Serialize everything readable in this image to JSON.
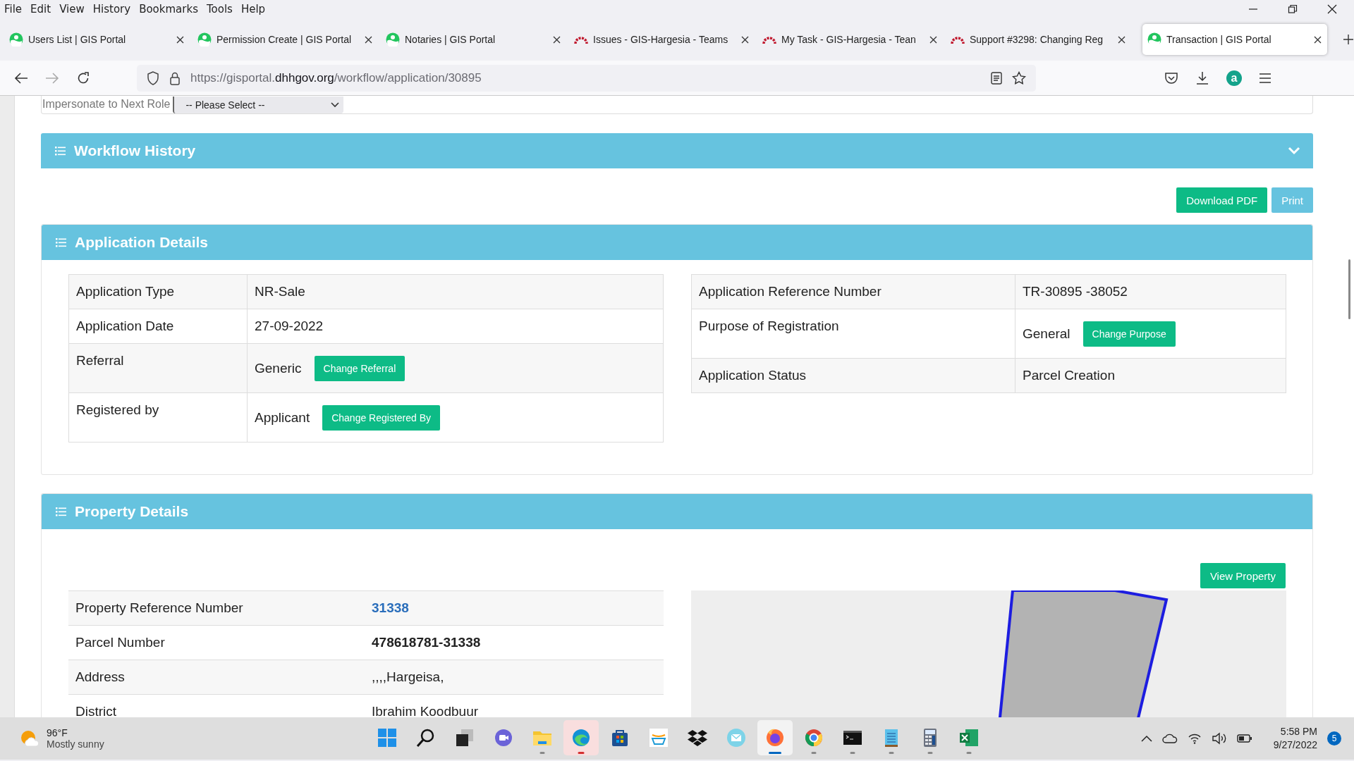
{
  "menu_bar": [
    "File",
    "Edit",
    "View",
    "History",
    "Bookmarks",
    "Tools",
    "Help"
  ],
  "tabs": [
    {
      "title": "Users List | GIS Portal",
      "kind": "portal",
      "selected": false
    },
    {
      "title": "Permission Create | GIS Portal",
      "kind": "portal",
      "selected": false
    },
    {
      "title": "Notaries | GIS Portal",
      "kind": "portal",
      "selected": false
    },
    {
      "title": "Issues - GIS-Hargesia - Teams",
      "kind": "tracker",
      "selected": false
    },
    {
      "title": "My Task - GIS-Hargesia - Tean",
      "kind": "tracker",
      "selected": false
    },
    {
      "title": "Support #3298: Changing Reg",
      "kind": "tracker",
      "selected": false
    },
    {
      "title": "Transaction | GIS Portal",
      "kind": "portal",
      "selected": true
    }
  ],
  "address_bar": {
    "scheme_host": "https://gisportal.",
    "domain": "dhhgov.org",
    "path": "/workflow/application/30895"
  },
  "account_badge": "a",
  "impersonate": {
    "label": "Impersonate to Next Role",
    "select_value": "-- Please Select --"
  },
  "workflow_history": {
    "title": "Workflow History"
  },
  "actions": [
    {
      "label": "Download PDF",
      "kind": "success"
    },
    {
      "label": "Print",
      "kind": "info"
    }
  ],
  "application_details": {
    "title": "Application Details",
    "left_rows": [
      {
        "label": "Application Type",
        "value": "NR-Sale"
      },
      {
        "label": "Application Date",
        "value": "27-09-2022"
      },
      {
        "label": "Referral",
        "value": "Generic",
        "action": "Change Referral"
      },
      {
        "label": "Registered by",
        "value": "Applicant",
        "action": "Change Registered By"
      }
    ],
    "right_rows": [
      {
        "label": "Application Reference Number",
        "value": "TR-30895 -38052"
      },
      {
        "label": "Purpose of Registration",
        "value": "General",
        "action": "Change Purpose"
      },
      {
        "label": "Application Status",
        "value": "Parcel Creation"
      }
    ]
  },
  "property_details": {
    "title": "Property Details",
    "view_button": "View Property",
    "rows": [
      {
        "label": "Property Reference Number",
        "value": "31338",
        "kind": "link"
      },
      {
        "label": "Parcel Number",
        "value": "478618781-31338",
        "kind": "bold"
      },
      {
        "label": "Address",
        "value": ",,,,Hargeisa,",
        "kind": "plain"
      },
      {
        "label": "District",
        "value": "Ibrahim Koodbuur",
        "kind": "plain"
      }
    ]
  },
  "taskbar": {
    "weather": {
      "temperature": "96°F",
      "condition": "Mostly sunny"
    },
    "apps": [
      {
        "kind": "start",
        "running": false,
        "selected": false,
        "attention": false
      },
      {
        "kind": "search",
        "running": false,
        "selected": false,
        "attention": false
      },
      {
        "kind": "taskview",
        "running": false,
        "selected": false,
        "attention": false
      },
      {
        "kind": "chat",
        "running": false,
        "selected": false,
        "attention": false
      },
      {
        "kind": "explorer",
        "running": true,
        "selected": false,
        "attention": false
      },
      {
        "kind": "edge",
        "running": true,
        "selected": false,
        "attention": true
      },
      {
        "kind": "store",
        "running": false,
        "selected": false,
        "attention": false
      },
      {
        "kind": "amazon",
        "running": false,
        "selected": false,
        "attention": false
      },
      {
        "kind": "dropbox",
        "running": false,
        "selected": false,
        "attention": false
      },
      {
        "kind": "mail",
        "running": false,
        "selected": false,
        "attention": false
      },
      {
        "kind": "firefox",
        "running": true,
        "selected": true,
        "attention": false
      },
      {
        "kind": "chrome",
        "running": true,
        "selected": false,
        "attention": false
      },
      {
        "kind": "terminal",
        "running": true,
        "selected": false,
        "attention": false
      },
      {
        "kind": "notepad",
        "running": true,
        "selected": false,
        "attention": false
      },
      {
        "kind": "calculator",
        "running": true,
        "selected": false,
        "attention": false
      },
      {
        "kind": "excel",
        "running": true,
        "selected": false,
        "attention": false
      }
    ],
    "time": "5:58 PM",
    "date": "9/27/2022",
    "notifications": "5"
  }
}
